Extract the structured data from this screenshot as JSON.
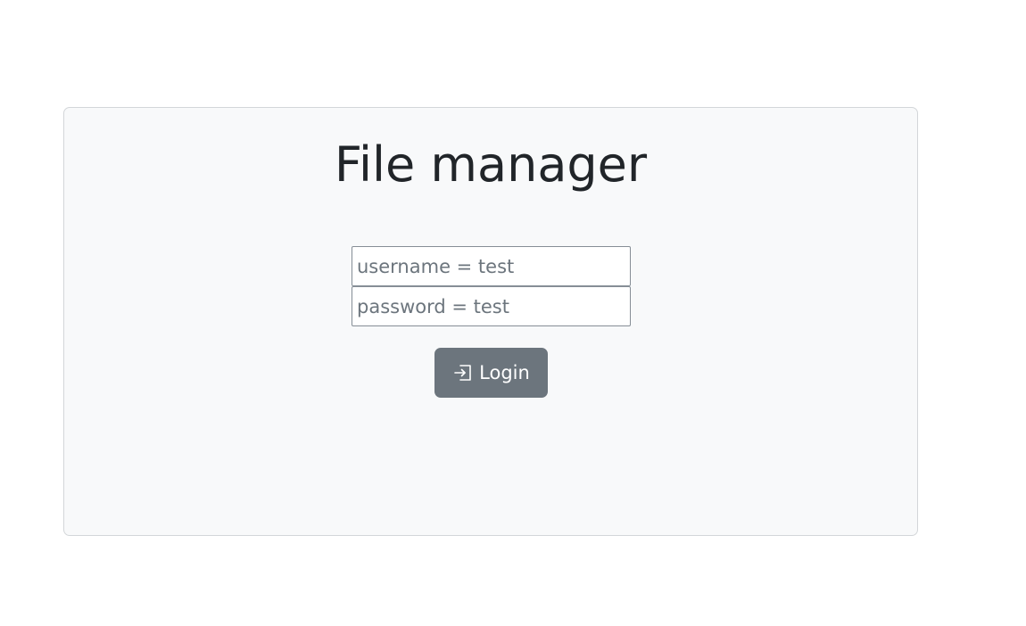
{
  "login": {
    "title": "File manager",
    "username_placeholder": "username = test",
    "password_placeholder": "password = test",
    "submit_label": "Login",
    "submit_icon": "box-arrow-in-right-icon"
  },
  "colors": {
    "card_background": "#f8f9fa",
    "button_background": "#6c757d",
    "title_text": "#212529"
  }
}
